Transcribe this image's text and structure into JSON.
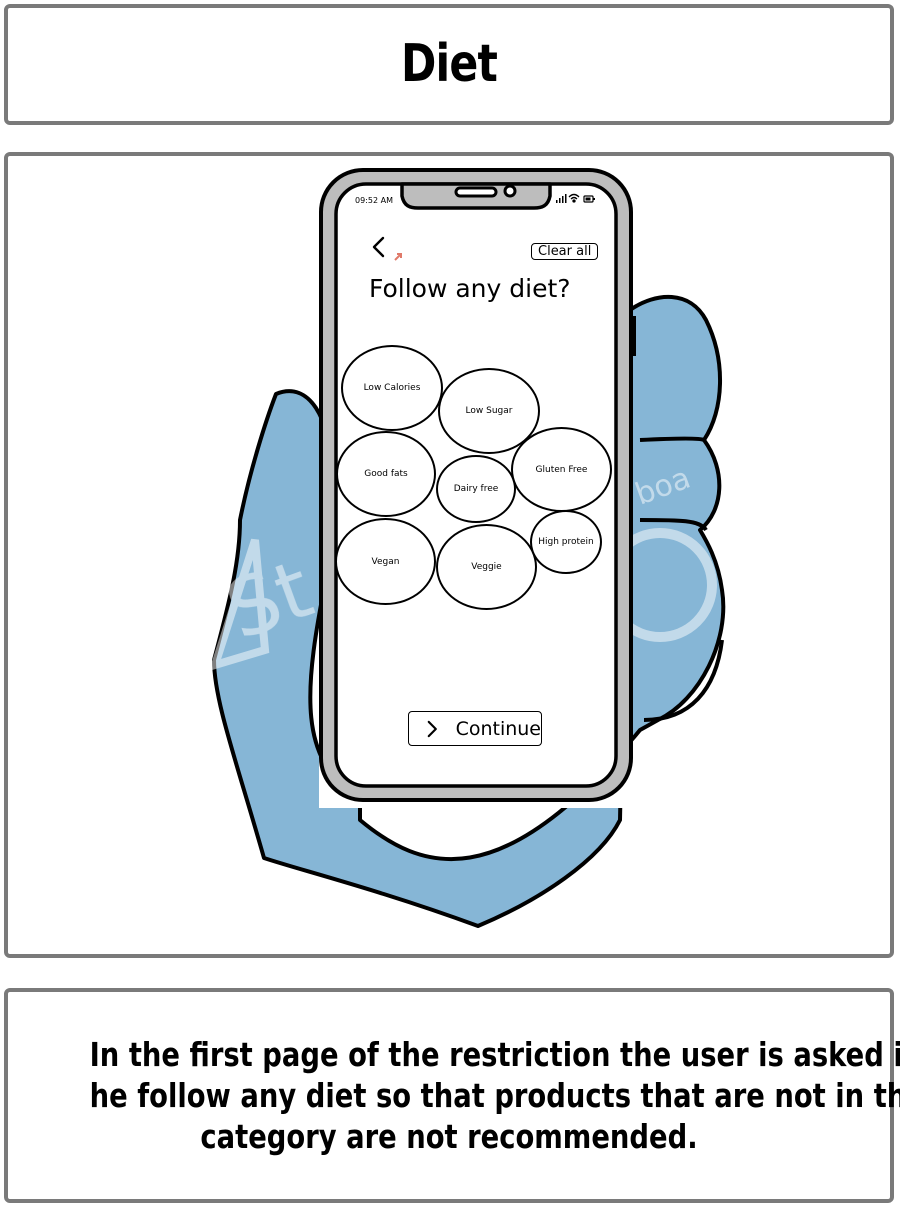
{
  "title": "Diet",
  "caption": {
    "line1": "In the first page of the restriction the user is asked if",
    "line2": "he follow any diet so that products that are not in this",
    "line3": "category are not recommended."
  },
  "watermark": {
    "text_large": "St",
    "text_small": "boa"
  },
  "colors": {
    "hand": "#86b6d6",
    "phone_frame": "#bdbdbd",
    "panel_border": "#7a7a7a",
    "link_marker": "#e07a6a"
  },
  "phone": {
    "status_bar": {
      "time": "09:52 AM",
      "icons": [
        "signal-icon",
        "wifi-icon",
        "battery-icon"
      ]
    },
    "back_icon": "chevron-left-icon",
    "clear_all": "Clear all",
    "screen_title": "Follow any diet?",
    "diet_options": [
      "Low Calories",
      "Low Sugar",
      "Good fats",
      "Dairy free",
      "Gluten Free",
      "Vegan",
      "Veggie",
      "High protein"
    ],
    "continue_label": "Continue",
    "continue_icon": "chevron-right-icon"
  }
}
